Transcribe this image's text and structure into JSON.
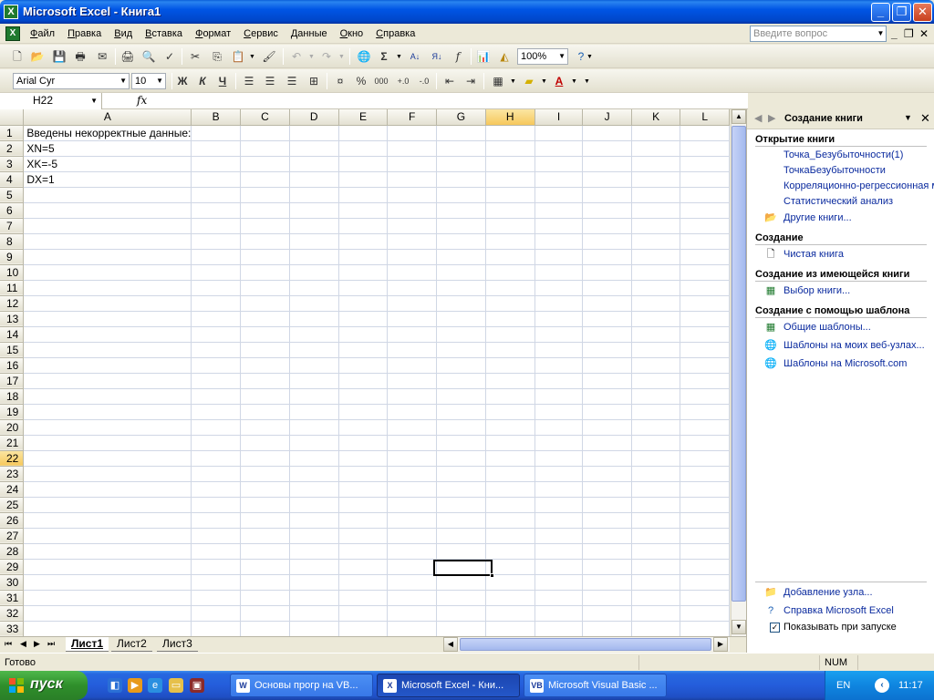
{
  "window": {
    "title": "Microsoft Excel - Книга1",
    "app_icon_letter": "X"
  },
  "menu": {
    "items": [
      "Файл",
      "Правка",
      "Вид",
      "Вставка",
      "Формат",
      "Сервис",
      "Данные",
      "Окно",
      "Справка"
    ],
    "ask_placeholder": "Введите вопрос"
  },
  "toolbar_standard": {
    "zoom": "100%"
  },
  "toolbar_formatting": {
    "font_name": "Arial Cyr",
    "font_size": "10",
    "bold_label": "Ж",
    "italic_label": "К",
    "underline_label": "Ч",
    "percent_label": "%",
    "thousands_label": "000"
  },
  "formula_bar": {
    "name_box": "H22",
    "fx_label": "fx",
    "content": ""
  },
  "sheet": {
    "columns": [
      "A",
      "B",
      "C",
      "D",
      "E",
      "F",
      "G",
      "H",
      "I",
      "J",
      "K",
      "L"
    ],
    "row_count": 33,
    "active_cell": "H22",
    "active_column": "H",
    "active_row": 22,
    "cells": {
      "A1": "Введены некорректные данные:",
      "A2": "XN=5",
      "A3": "XK=-5",
      "A4": "DX=1"
    },
    "tabs": [
      "Лист1",
      "Лист2",
      "Лист3"
    ],
    "active_tab": "Лист1"
  },
  "status_bar": {
    "ready": "Готово",
    "num": "NUM"
  },
  "task_pane": {
    "title": "Создание книги",
    "sections": {
      "open": {
        "title": "Открытие книги",
        "links": [
          "Точка_Безубыточности(1)",
          "ТочкаБезубыточности",
          "Корреляционно-регрессионная мо",
          "Статистический анализ"
        ],
        "more": "Другие книги..."
      },
      "new": {
        "title": "Создание",
        "links": [
          "Чистая книга"
        ]
      },
      "from_existing": {
        "title": "Создание из имеющейся книги",
        "links": [
          "Выбор книги..."
        ]
      },
      "from_template": {
        "title": "Создание с помощью шаблона",
        "links": [
          "Общие шаблоны...",
          "Шаблоны на моих веб-узлах...",
          "Шаблоны на Microsoft.com"
        ]
      }
    },
    "bottom": {
      "add_node": "Добавление узла...",
      "help": "Справка Microsoft Excel",
      "show_on_startup": "Показывать при запуске",
      "show_on_startup_checked": true
    }
  },
  "taskbar": {
    "start_label": "пуск",
    "tasks": [
      {
        "label": "Основы прогр на VB...",
        "active": false
      },
      {
        "label": "Microsoft Excel - Кни...",
        "active": true
      },
      {
        "label": "Microsoft Visual Basic ...",
        "active": false
      }
    ],
    "language": "EN",
    "clock": "11:17"
  }
}
